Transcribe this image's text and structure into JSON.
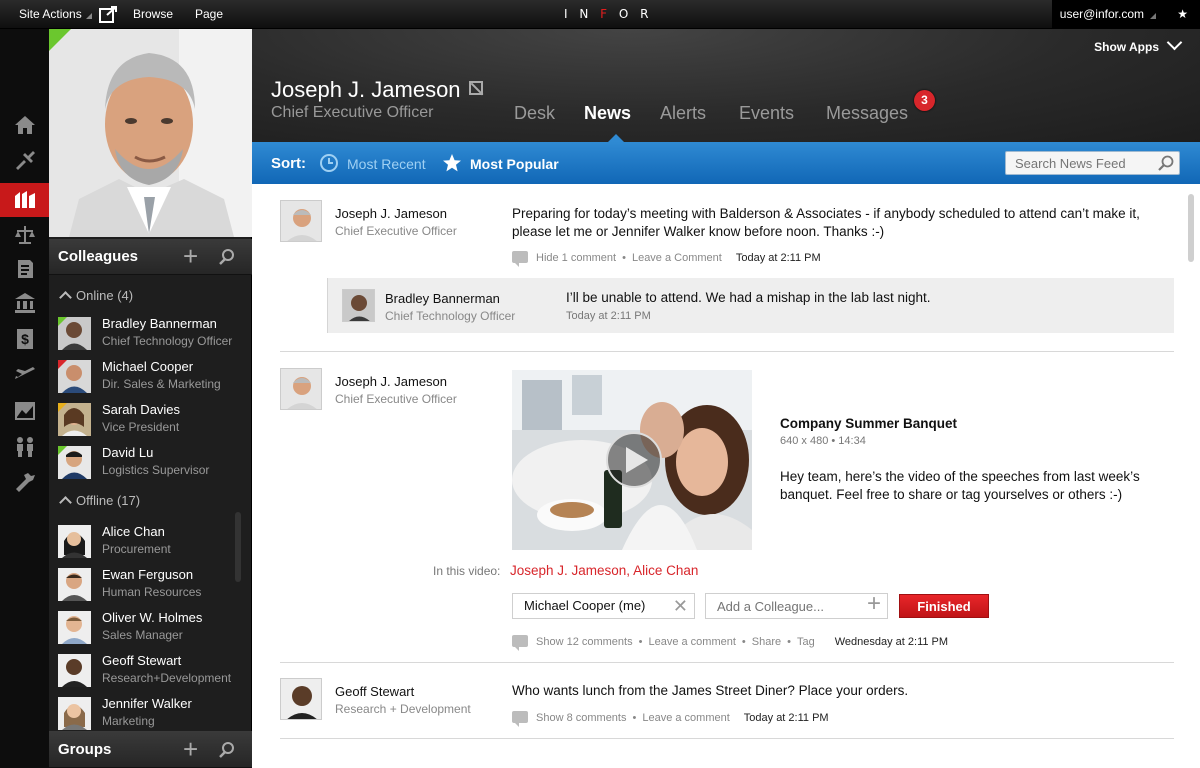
{
  "topbar": {
    "site_actions": "Site Actions",
    "browse": "Browse",
    "page": "Page",
    "logo": "INFOR",
    "user_email": "user@infor.com"
  },
  "colors": {
    "accent_red": "#d8262b",
    "blue": "#1a75c5",
    "online": "#6bc72e"
  },
  "rail": {
    "icons": [
      "home-icon",
      "tools-icon",
      "building-icon",
      "balance-icon",
      "document-icon",
      "bank-icon",
      "dollar-icon",
      "plane-icon",
      "chart-icon",
      "people-icon",
      "wrench-icon"
    ],
    "active_index": 2
  },
  "colleagues": {
    "title": "Colleagues",
    "online_label": "Online (4)",
    "offline_label": "Offline (17)",
    "online": [
      {
        "name": "Bradley Bannerman",
        "role": "Chief Technology Officer"
      },
      {
        "name": "Michael Cooper",
        "role": "Dir. Sales & Marketing"
      },
      {
        "name": "Sarah Davies",
        "role": "Vice President"
      },
      {
        "name": "David Lu",
        "role": "Logistics Supervisor"
      }
    ],
    "offline": [
      {
        "name": "Alice Chan",
        "role": "Procurement"
      },
      {
        "name": "Ewan Ferguson",
        "role": "Human Resources"
      },
      {
        "name": "Oliver W. Holmes",
        "role": "Sales Manager"
      },
      {
        "name": "Geoff Stewart",
        "role": "Research+Development"
      },
      {
        "name": "Jennifer Walker",
        "role": "Marketing"
      }
    ]
  },
  "groups": {
    "title": "Groups"
  },
  "header": {
    "show_apps": "Show Apps",
    "user_name": "Joseph J. Jameson",
    "user_title": "Chief Executive Officer",
    "tabs": [
      "Desk",
      "News",
      "Alerts",
      "Events",
      "Messages"
    ],
    "active_tab": "News",
    "messages_badge": "3"
  },
  "sort": {
    "label": "Sort:",
    "most_recent": "Most Recent",
    "most_popular": "Most Popular",
    "search_placeholder": "Search News Feed"
  },
  "feed": {
    "post1": {
      "name": "Joseph J. Jameson",
      "role": "Chief Executive Officer",
      "text": "Preparing for today’s meeting with Balderson & Associates - if anybody scheduled to attend can’t make it, please let me or Jennifer Walker know before noon. Thanks :-)",
      "hide_comment": "Hide 1 comment",
      "leave_comment": "Leave a Comment",
      "time": "Today at 2:11 PM",
      "reply": {
        "name": "Bradley Bannerman",
        "role": "Chief Technology Officer",
        "text": "I’ll be unable to attend. We had a mishap in the lab last night.",
        "time": "Today at 2:11 PM"
      }
    },
    "post2": {
      "name": "Joseph J. Jameson",
      "role": "Chief Executive Officer",
      "video_title": "Company Summer Banquet",
      "video_meta": "640 x 480 • 14:34",
      "text": "Hey team, here’s the video of the speeches from last week’s banquet. Feel free to share or tag yourselves or others :-)",
      "in_this_video": "In this video:",
      "tagged": "Joseph J. Jameson, Alice Chan",
      "tag_chip": "Michael Cooper (me)",
      "add_placeholder": "Add a Colleague...",
      "finished": "Finished",
      "show_comments": "Show 12 comments",
      "leave_comment": "Leave a comment",
      "share": "Share",
      "tag": "Tag",
      "time": "Wednesday at 2:11 PM"
    },
    "post3": {
      "name": "Geoff Stewart",
      "role": "Research + Development",
      "text": "Who wants lunch from the James Street Diner? Place your orders.",
      "show_comments": "Show 8 comments",
      "leave_comment": "Leave a comment",
      "time": "Today at 2:11 PM"
    }
  }
}
